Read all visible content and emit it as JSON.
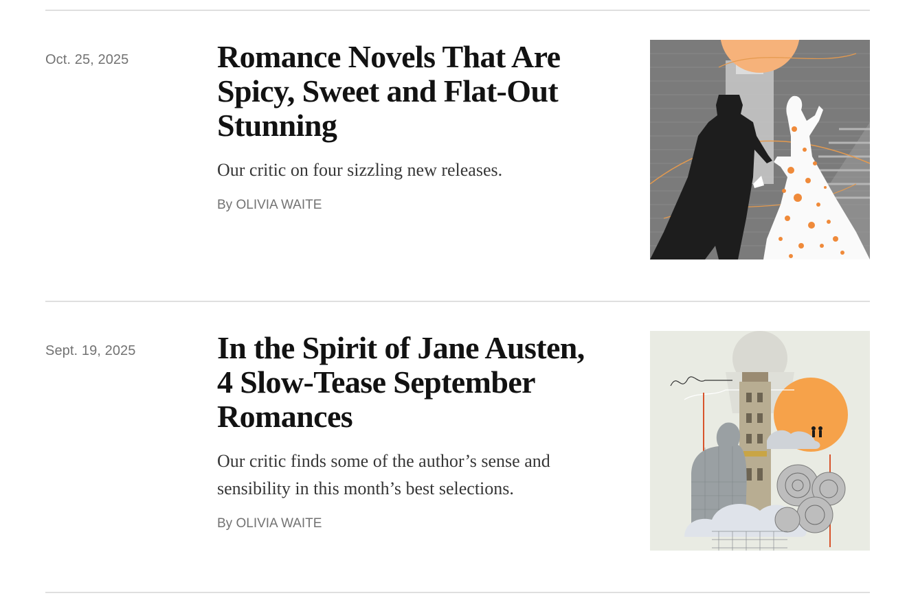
{
  "articles": [
    {
      "date": "Oct. 25, 2025",
      "headline": "Romance Novels That Are Spicy, Sweet and Flat-Out Stunning",
      "summary": "Our critic on four sizzling new releases.",
      "byline_prefix": "By",
      "author": "OLIVIA WAITE",
      "image": "illustration-silhouette-couple-staircase"
    },
    {
      "date": "Sept. 19, 2025",
      "headline": "In the Spirit of Jane Austen, 4 Slow-Tease September Romances",
      "summary": "Our critic finds some of the author’s sense and sensibility in this month’s best selections.",
      "byline_prefix": "By",
      "author": "OLIVIA WAITE",
      "image": "collage-tower-roses-orange-sun"
    }
  ],
  "colors": {
    "rule": "#dfdfdf",
    "meta_text": "#727272",
    "headline": "#121212",
    "summary": "#363636",
    "accent_orange": "#f6a24a"
  }
}
